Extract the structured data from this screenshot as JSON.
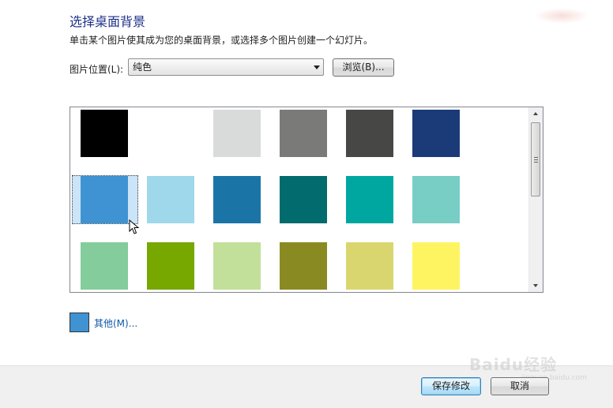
{
  "header": {
    "title": "选择桌面背景",
    "subtitle": "单击某个图片使其成为您的桌面背景，或选择多个图片创建一个幻灯片。"
  },
  "picture_position": {
    "label": "图片位置(L):",
    "selected_value": "纯色"
  },
  "browse_label": "浏览(B)...",
  "colors": {
    "rows": [
      [
        "#000000",
        "#ffffff",
        "#d9dbda",
        "#7a7b79",
        "#474845",
        "#1b3b78"
      ],
      [
        "#3f93d2",
        "#9ed8ea",
        "#1a75a6",
        "#026b6e",
        "#00a7a1",
        "#78cdc5"
      ],
      [
        "#84cc9b",
        "#76a800",
        "#c2e09a",
        "#8a8a23",
        "#dad66f",
        "#fef462"
      ]
    ],
    "selected_row": 1,
    "selected_col": 0
  },
  "other": {
    "color": "#3f93d2",
    "label": "其他(M)..."
  },
  "footer": {
    "save_label": "保存修改",
    "cancel_label": "取消"
  },
  "watermark": {
    "text": "Baidu经验",
    "url": "jingyan.baidu.com"
  }
}
